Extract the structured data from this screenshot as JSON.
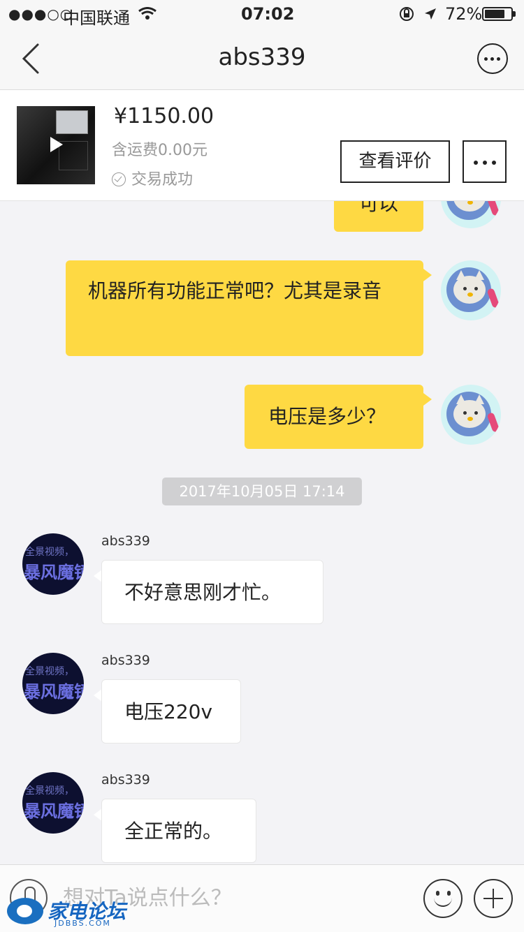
{
  "status_bar": {
    "signal": "●●●○○",
    "carrier": "中国联通",
    "time": "07:02",
    "battery": "72%"
  },
  "nav": {
    "title": "abs339"
  },
  "product": {
    "price": "¥1150.00",
    "shipping": "含运费0.00元",
    "status": "交易成功",
    "review_button": "查看评价"
  },
  "messages": [
    {
      "from": "me",
      "text": "可以"
    },
    {
      "from": "me",
      "text": "机器所有功能正常吧？尤其是录音"
    },
    {
      "from": "me",
      "text": "电压是多少？"
    },
    {
      "from": "seller",
      "sender": "abs339",
      "text": "不好意思刚才忙。"
    },
    {
      "from": "seller",
      "sender": "abs339",
      "text": "电压220v"
    },
    {
      "from": "seller",
      "sender": "abs339",
      "text": "全正常的。"
    }
  ],
  "timestamp": "2017年10月05日 17:14",
  "seller_avatar": {
    "line1": "全景视频，",
    "line2": "暴风魔镜"
  },
  "input": {
    "placeholder": "想对Ta说点什么？"
  },
  "watermark": {
    "title": "家电论坛",
    "sub": "JDBBS.COM"
  },
  "colors": {
    "my_bubble": "#fed943",
    "their_bubble": "#ffffff",
    "background": "#f3f3f6"
  }
}
